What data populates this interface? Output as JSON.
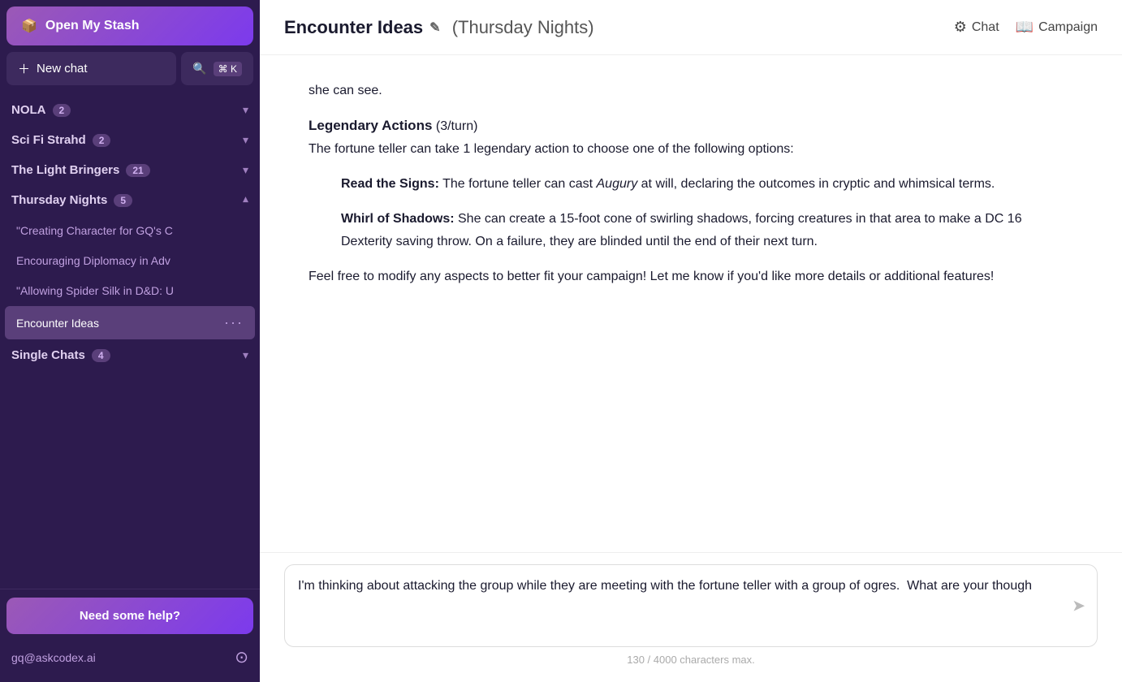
{
  "sidebar": {
    "open_stash_label": "Open My Stash",
    "new_chat_label": "New chat",
    "search_label": "⌘ K",
    "sections": [
      {
        "id": "nola",
        "label": "NOLA",
        "count": 2,
        "expanded": false,
        "items": []
      },
      {
        "id": "scifi-strahd",
        "label": "Sci Fi Strahd",
        "count": 2,
        "expanded": false,
        "items": []
      },
      {
        "id": "light-bringers",
        "label": "The Light Bringers",
        "count": 21,
        "expanded": false,
        "items": []
      },
      {
        "id": "thursday-nights",
        "label": "Thursday Nights",
        "count": 5,
        "expanded": true,
        "items": [
          {
            "id": "creating-character",
            "label": "\"Creating Character for GQ's C",
            "active": false
          },
          {
            "id": "encouraging-diplomacy",
            "label": "Encouraging Diplomacy in Adv",
            "active": false
          },
          {
            "id": "allowing-spider-silk",
            "label": "\"Allowing Spider Silk in D&D: U",
            "active": false
          },
          {
            "id": "encounter-ideas",
            "label": "Encounter Ideas",
            "active": true
          }
        ]
      },
      {
        "id": "single-chats",
        "label": "Single Chats",
        "count": 4,
        "expanded": false,
        "items": []
      }
    ],
    "help_label": "Need some help?",
    "user_email": "gq@askcodex.ai"
  },
  "topbar": {
    "chat_title": "Encounter Ideas",
    "campaign_label": "(Thursday Nights)",
    "chat_action_label": "Chat",
    "campaign_action_label": "Campaign"
  },
  "content": {
    "intro_text": "she can see.",
    "legendary_actions_heading": "Legendary Actions",
    "legendary_actions_detail": "(3/turn)",
    "legendary_actions_intro": "The fortune teller can take 1 legendary action to choose one of the following options:",
    "read_signs_heading": "Read the Signs:",
    "read_signs_text": "The fortune teller can cast Augury at will, declaring the outcomes in cryptic and whimsical terms.",
    "whirl_heading": "Whirl of Shadows:",
    "whirl_text": "She can create a 15-foot cone of swirling shadows, forcing creatures in that area to make a DC 16 Dexterity saving throw. On a failure, they are blinded until the end of their next turn.",
    "closing_text": "Feel free to modify any aspects to better fit your campaign! Let me know if you'd like more details or additional features!"
  },
  "input": {
    "value": "I'm thinking about attacking the group while they are meeting with the fortune teller with a group of ogres.  What are your though",
    "char_count": "130 / 4000 characters max."
  }
}
